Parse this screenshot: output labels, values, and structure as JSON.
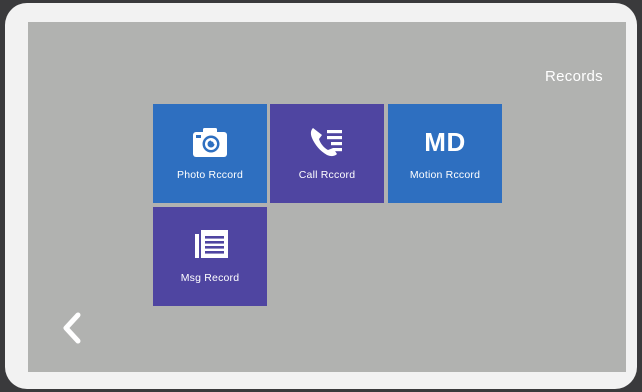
{
  "header": {
    "title": "Records"
  },
  "tiles": [
    {
      "label": "Photo Rccord",
      "icon": "camera-icon",
      "color": "#2e6fc0"
    },
    {
      "label": "Call Rccord",
      "icon": "phone-list-icon",
      "color": "#4f45a1"
    },
    {
      "label": "Motion Rccord",
      "icon_text": "MD",
      "icon": "md-text-icon",
      "color": "#2e6fc0"
    },
    {
      "label": "Msg Record",
      "icon": "message-doc-icon",
      "color": "#4f45a1"
    }
  ],
  "nav": {
    "back_icon": "chevron-left-icon"
  },
  "colors": {
    "screen_bg": "#b1b2b0",
    "bezel": "#f2f2f2",
    "blue_tile": "#2e6fc0",
    "purple_tile": "#4f45a1"
  }
}
